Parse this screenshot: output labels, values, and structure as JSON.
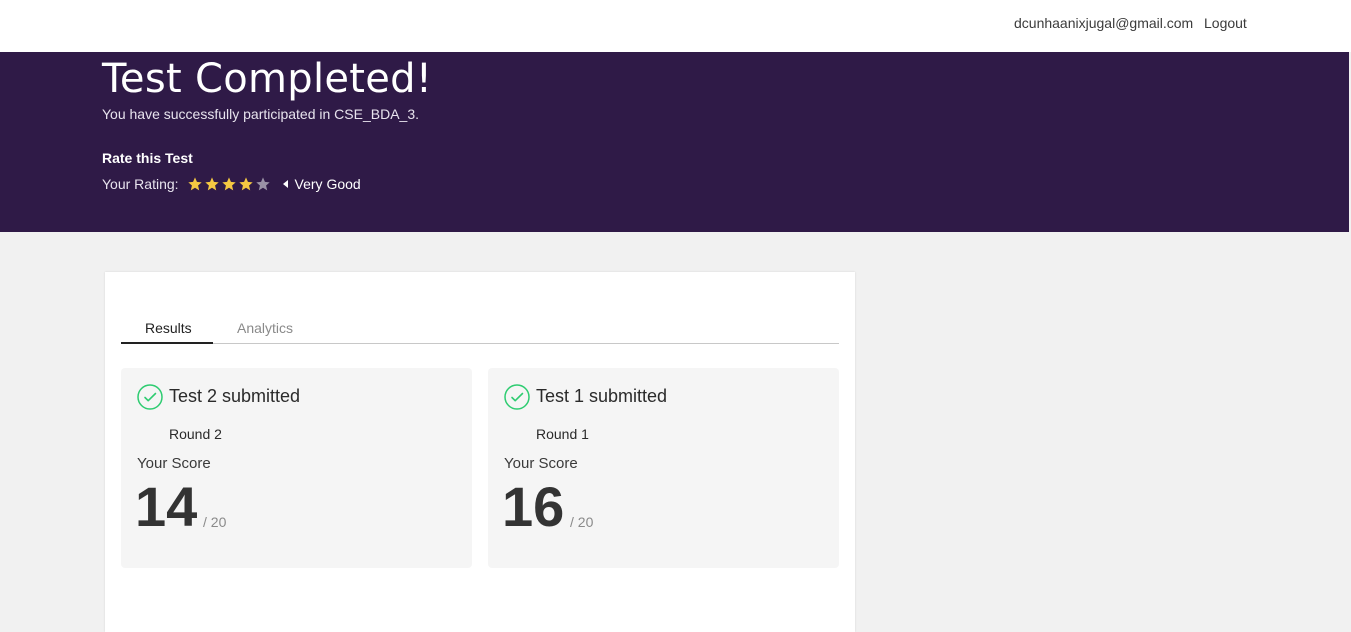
{
  "topbar": {
    "email": "dcunhaanixjugal@gmail.com",
    "logout_label": "Logout"
  },
  "hero": {
    "title": "Test Completed!",
    "subtitle": "You have successfully participated in CSE_BDA_3.",
    "rate_heading": "Rate this Test",
    "rating_prefix": "Your Rating:",
    "rating_value": 4,
    "rating_max": 5,
    "rating_label": "Very Good"
  },
  "tabs": [
    {
      "label": "Results",
      "active": true
    },
    {
      "label": "Analytics",
      "active": false
    }
  ],
  "results": [
    {
      "title": "Test 2 submitted",
      "round": "Round 2",
      "score_label": "Your Score",
      "score": "14",
      "total": "/ 20"
    },
    {
      "title": "Test 1 submitted",
      "round": "Round 1",
      "score_label": "Your Score",
      "score": "16",
      "total": "/ 20"
    }
  ],
  "colors": {
    "banner": "#2f1a47",
    "star_filled": "#f5c842",
    "star_empty": "#9a92a6",
    "check": "#2ecc71"
  }
}
